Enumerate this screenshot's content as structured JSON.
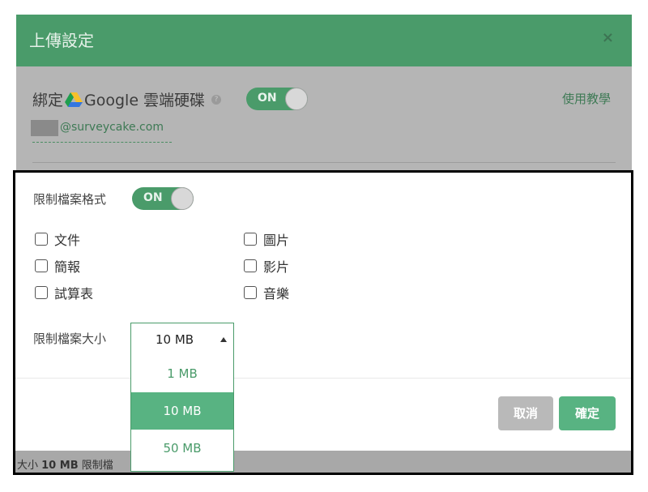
{
  "modal": {
    "title": "上傳設定",
    "close_glyph": "×"
  },
  "gdrive_section": {
    "label_prefix": "綁定",
    "label_google": "Google 雲端硬碟",
    "help_glyph": "?",
    "toggle_label": "ON",
    "tutorial_link": "使用教學",
    "email": "@surveycake.com"
  },
  "format_section": {
    "label": "限制檔案格式",
    "toggle_label": "ON",
    "checkboxes": [
      {
        "label": "文件",
        "checked": false
      },
      {
        "label": "圖片",
        "checked": false
      },
      {
        "label": "簡報",
        "checked": false
      },
      {
        "label": "影片",
        "checked": false
      },
      {
        "label": "試算表",
        "checked": false
      },
      {
        "label": "音樂",
        "checked": false
      }
    ]
  },
  "size_section": {
    "label": "限制檔案大小",
    "selected": "10 MB",
    "options": [
      "1 MB",
      "10 MB",
      "50 MB"
    ],
    "selected_index": 1
  },
  "buttons": {
    "cancel": "取消",
    "confirm": "確定"
  },
  "strip": {
    "text_prefix": "大小 ",
    "text_bold": "10 MB",
    "text_suffix": " 限制檔"
  },
  "colors": {
    "accent": "#4a9b6a",
    "accent_light": "#58b382",
    "overlay_gray": "#b5b5b5"
  }
}
